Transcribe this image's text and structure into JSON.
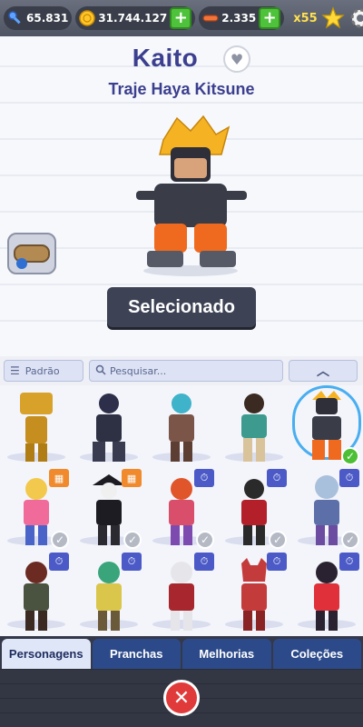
{
  "currencies": {
    "keys": "65.831",
    "coins": "31.744.127",
    "boards": "2.335",
    "multiplier": "x55"
  },
  "icons": {
    "key": "key-icon",
    "coin": "coin-icon",
    "board": "hoverboard-icon",
    "star": "star-icon",
    "settings": "gear-icon",
    "heart": "heart-icon",
    "search": "search-icon",
    "menu": "menu-icon",
    "calendar": "calendar-icon",
    "clock": "stopwatch-icon",
    "check": "check-icon",
    "close": "close-icon"
  },
  "hero": {
    "name": "Kaito",
    "outfit": "Traje Haya Kitsune",
    "select_label": "Selecionado"
  },
  "filters": {
    "sort_label": "Padrão",
    "search_placeholder": "Pesquisar..."
  },
  "tabs": [
    "Personagens",
    "Pranchas",
    "Melhorias",
    "Coleções"
  ],
  "colors": {
    "accent": "#3b3f8f",
    "plus": "#4fc23b",
    "selected_ring": "#49aef0",
    "close": "#e03a3a"
  }
}
